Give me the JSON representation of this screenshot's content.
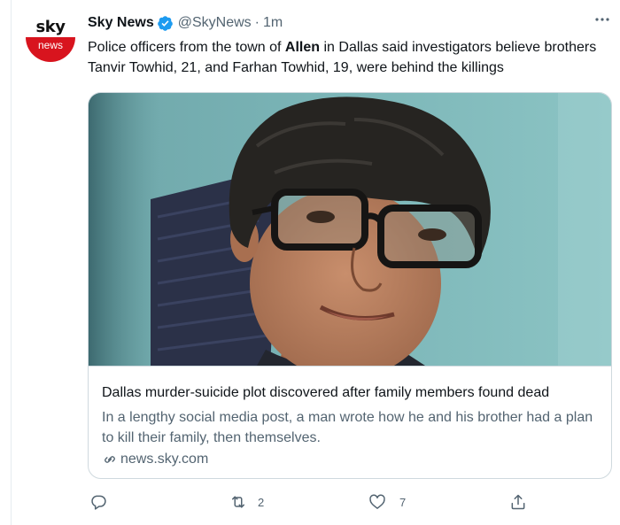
{
  "author": {
    "avatar_top": "sky",
    "avatar_bottom": "news",
    "display_name": "Sky News",
    "handle": "@SkyNews",
    "separator": "·",
    "time": "1m"
  },
  "tweet": {
    "text_before": "Police officers from the town of ",
    "text_bold": "Allen",
    "text_after": " in Dallas said investigators believe brothers Tanvir Towhid, 21, and Farhan Towhid, 19, were behind the killings"
  },
  "card": {
    "title": "Dallas murder-suicide plot discovered after family members found dead",
    "description": "In a lengthy social media post, a man wrote how he and his brother had a plan to kill their family, then themselves.",
    "domain": "news.sky.com"
  },
  "actions": {
    "reply_count": "",
    "retweet_count": "2",
    "like_count": "7"
  },
  "icons": {
    "verified": "verified-badge-icon",
    "more": "more-icon",
    "link": "link-icon",
    "reply": "reply-icon",
    "retweet": "retweet-icon",
    "like": "like-icon",
    "share": "share-icon"
  },
  "colors": {
    "accent": "#1d9bf0",
    "text": "#0f1419",
    "muted": "#536471",
    "border": "#cfd9de",
    "brand_red": "#d8141e"
  }
}
